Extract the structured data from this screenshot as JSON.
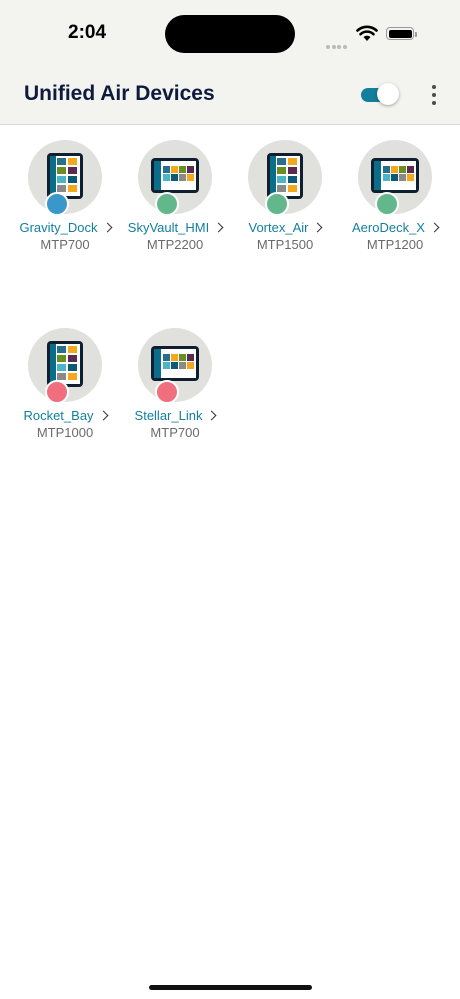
{
  "status_bar": {
    "time": "2:04"
  },
  "header": {
    "title": "Unified Air Devices",
    "toggle_on": true
  },
  "colors": {
    "accent": "#137f9c",
    "status_blue": "#3a97c9",
    "status_green": "#62b88a",
    "status_red": "#ef6f7f"
  },
  "devices": [
    {
      "name": "Gravity_Dock",
      "model": "MTP700",
      "status": "blue",
      "orientation": "portrait"
    },
    {
      "name": "SkyVault_HMI",
      "model": "MTP2200",
      "status": "green",
      "orientation": "landscape"
    },
    {
      "name": "Vortex_Air",
      "model": "MTP1500",
      "status": "green",
      "orientation": "portrait"
    },
    {
      "name": "AeroDeck_X",
      "model": "MTP1200",
      "status": "green",
      "orientation": "landscape"
    },
    {
      "name": "Rocket_Bay",
      "model": "MTP1000",
      "status": "red",
      "orientation": "portrait"
    },
    {
      "name": "Stellar_Link",
      "model": "MTP700",
      "status": "red",
      "orientation": "landscape"
    }
  ]
}
